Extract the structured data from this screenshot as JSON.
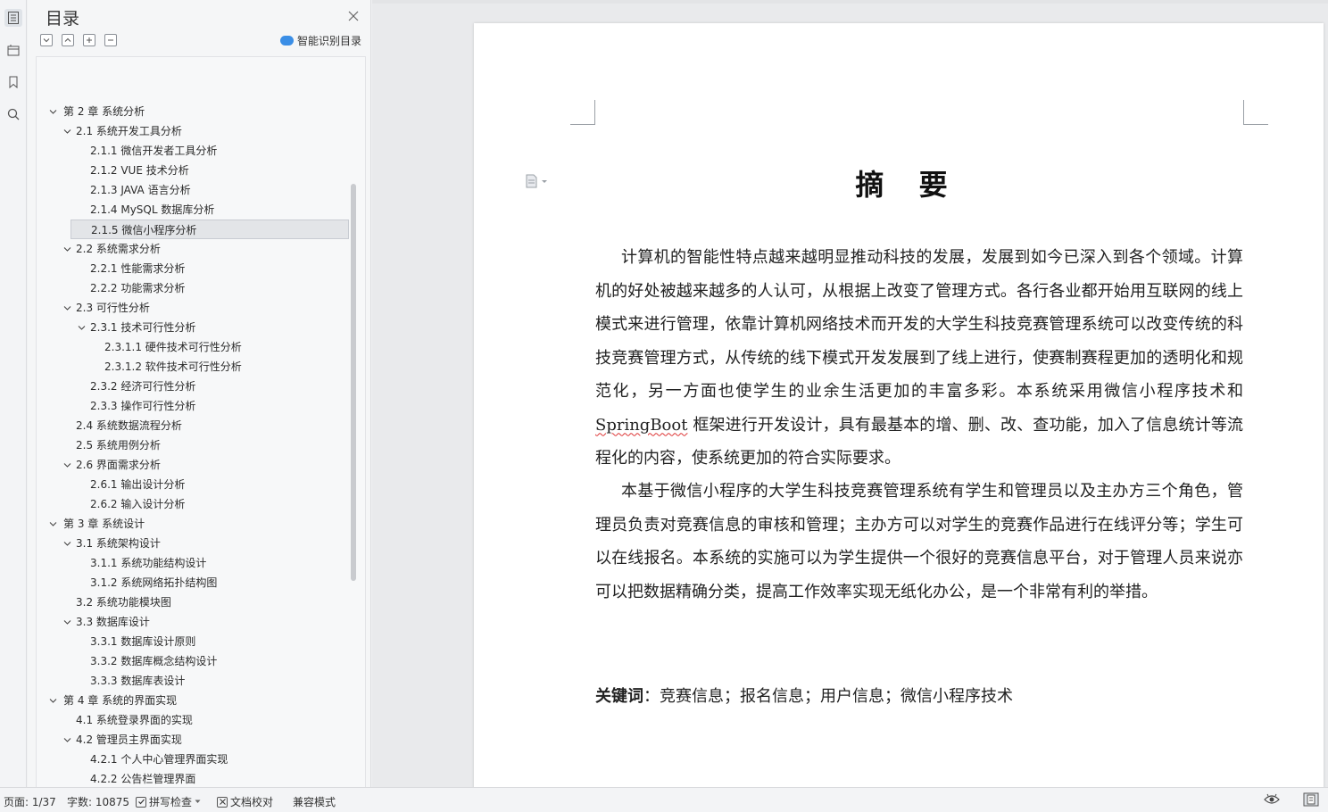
{
  "toc_panel": {
    "title": "目录",
    "smart_toc_label": "智能识别目录",
    "items": [
      {
        "label": "第 2 章  系统分析",
        "level": 0,
        "caret": true
      },
      {
        "label": "2.1  系统开发工具分析",
        "level": 1,
        "caret": true
      },
      {
        "label": "2.1.1  微信开发者工具分析",
        "level": 2,
        "caret": false
      },
      {
        "label": "2.1.2 VUE 技术分析",
        "level": 2,
        "caret": false
      },
      {
        "label": "2.1.3 JAVA 语言分析",
        "level": 2,
        "caret": false
      },
      {
        "label": "2.1.4 MySQL 数据库分析",
        "level": 2,
        "caret": false
      },
      {
        "label": "2.1.5 微信小程序分析",
        "level": 2,
        "caret": false,
        "selected": true
      },
      {
        "label": "2.2 系统需求分析",
        "level": 1,
        "caret": true
      },
      {
        "label": "2.2.1  性能需求分析",
        "level": 2,
        "caret": false
      },
      {
        "label": "2.2.2  功能需求分析",
        "level": 2,
        "caret": false
      },
      {
        "label": "2.3 可行性分析",
        "level": 1,
        "caret": true
      },
      {
        "label": "2.3.1  技术可行性分析",
        "level": 2,
        "caret": true
      },
      {
        "label": "2.3.1.1 硬件技术可行性分析",
        "level": 3,
        "caret": false
      },
      {
        "label": "2.3.1.2 软件技术可行性分析",
        "level": 3,
        "caret": false
      },
      {
        "label": "2.3.2  经济可行性分析",
        "level": 2,
        "caret": false
      },
      {
        "label": "2.3.3  操作可行性分析",
        "level": 2,
        "caret": false
      },
      {
        "label": "2.4  系统数据流程分析",
        "level": 1,
        "caret": false
      },
      {
        "label": "2.5 系统用例分析",
        "level": 1,
        "caret": false
      },
      {
        "label": "2.6  界面需求分析",
        "level": 1,
        "caret": true
      },
      {
        "label": "2.6.1 输出设计分析",
        "level": 2,
        "caret": false
      },
      {
        "label": "2.6.2 输入设计分析",
        "level": 2,
        "caret": false
      },
      {
        "label": "第 3 章  系统设计",
        "level": 0,
        "caret": true
      },
      {
        "label": "3.1  系统架构设计",
        "level": 1,
        "caret": true
      },
      {
        "label": "3.1.1  系统功能结构设计",
        "level": 2,
        "caret": false
      },
      {
        "label": "3.1.2 系统网络拓扑结构图",
        "level": 2,
        "caret": false
      },
      {
        "label": "3.2  系统功能模块图",
        "level": 1,
        "caret": false
      },
      {
        "label": "3.3 数据库设计",
        "level": 1,
        "caret": true
      },
      {
        "label": "3.3.1 数据库设计原则",
        "level": 2,
        "caret": false
      },
      {
        "label": "3.3.2  数据库概念结构设计",
        "level": 2,
        "caret": false
      },
      {
        "label": "3.3.3  数据库表设计",
        "level": 2,
        "caret": false
      },
      {
        "label": "第 4 章  系统的界面实现",
        "level": 0,
        "caret": true
      },
      {
        "label": "4.1 系统登录界面的实现",
        "level": 1,
        "caret": false
      },
      {
        "label": "4.2 管理员主界面实现",
        "level": 1,
        "caret": true
      },
      {
        "label": "4.2.1 个人中心管理界面实现",
        "level": 2,
        "caret": false
      },
      {
        "label": "4.2.2 公告栏管理界面",
        "level": 2,
        "caret": false
      }
    ]
  },
  "document": {
    "title": "摘 要",
    "para1_a": "计算机的智能性特点越来越明显推动科技的发展，发展到如今已深入到各个领域。计算机的好处被越来越多的人认可，从根据上改变了管理方式。各行各业都开始用互联网的线上模式来进行管理，依靠计算机网络技术而开发的大学生科技竞赛管理系统可以改变传统的科技竞赛管理方式，从传统的线下模式开发发展到了线上进行，使赛制赛程更加的透明化和规范化，另一方面也使学生的业余生活更加的丰富多彩。本系统采用微信小程序技术和 ",
    "para1_spring": "SpringBoot",
    "para1_b": " 框架进行开发设计，具有最基本的增、删、改、查功能，加入了信息统计等流程化的内容，使系统更加的符合实际要求。",
    "para2": "本基于微信小程序的大学生科技竞赛管理系统有学生和管理员以及主办方三个角色，管理员负责对竞赛信息的审核和管理；主办方可以对学生的竞赛作品进行在线评分等；学生可以在线报名。本系统的实施可以为学生提供一个很好的竞赛信息平台，对于管理人员来说亦可以把数据精确分类，提高工作效率实现无纸化办公，是一个非常有利的举措。",
    "keywords_label": "关键词",
    "keywords_colon": "：",
    "keywords": "竞赛信息；报名信息；用户信息；微信小程序技术"
  },
  "status_bar": {
    "page": "页面: 1/37",
    "word_count": "字数: 10875",
    "spell_check": "拼写检查",
    "doc_proof": "文档校对",
    "compat_mode": "兼容模式"
  },
  "colors": {
    "accent": "#3a8ee6",
    "selected_bg": "#e3e5e8"
  }
}
